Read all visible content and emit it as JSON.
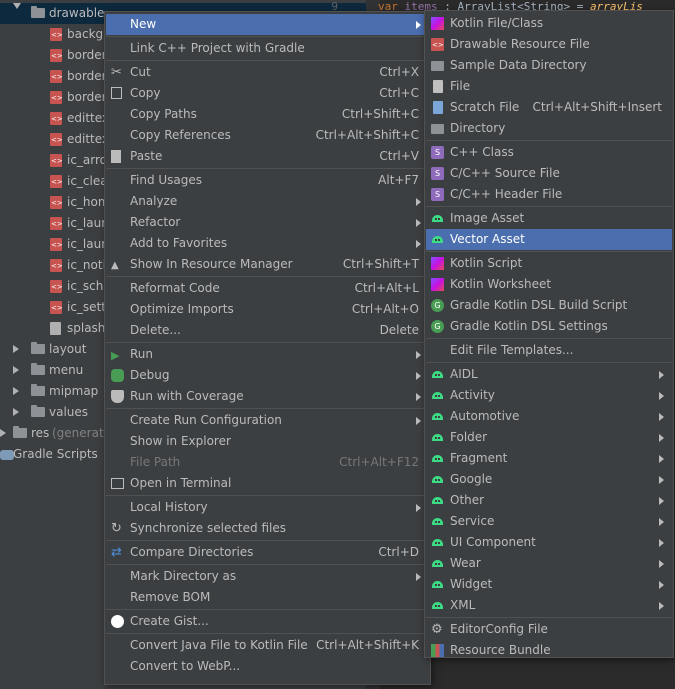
{
  "editor": {
    "line_number": "9",
    "keyword": "var",
    "var_name": "items",
    "type": ": ArrayList<String> =",
    "fn": "arrayLis"
  },
  "tree": {
    "drawable": "drawable",
    "files": [
      "backgro",
      "border_",
      "border_",
      "border_",
      "edittex",
      "edittex",
      "ic_arrov",
      "ic_clear",
      "ic_hom",
      "ic_laun",
      "ic_laun",
      "ic_notif",
      "ic_scho",
      "ic_setti",
      "splash_"
    ],
    "layout": "layout",
    "menu": "menu",
    "mipmap": "mipmap",
    "values": "values",
    "res": "res",
    "res_suffix": "(generated",
    "gradle": "Gradle Scripts"
  },
  "menu1": [
    {
      "label": "New",
      "shortcut": "",
      "sub": true,
      "sel": true
    },
    {
      "label": "Link C++ Project with Gradle",
      "shortcut": ""
    },
    {
      "label": "Cut",
      "shortcut": "Ctrl+X",
      "icon": "cut"
    },
    {
      "label": "Copy",
      "shortcut": "Ctrl+C",
      "icon": "copy"
    },
    {
      "label": "Copy Paths",
      "shortcut": "Ctrl+Shift+C"
    },
    {
      "label": "Copy References",
      "shortcut": "Ctrl+Alt+Shift+C"
    },
    {
      "label": "Paste",
      "shortcut": "Ctrl+V",
      "icon": "paste"
    },
    {
      "label": "Find Usages",
      "shortcut": "Alt+F7"
    },
    {
      "label": "Analyze",
      "shortcut": "",
      "sub": true
    },
    {
      "label": "Refactor",
      "shortcut": "",
      "sub": true
    },
    {
      "label": "Add to Favorites",
      "shortcut": "",
      "sub": true
    },
    {
      "label": "Show In Resource Manager",
      "shortcut": "Ctrl+Shift+T",
      "icon": "resource"
    },
    {
      "label": "Reformat Code",
      "shortcut": "Ctrl+Alt+L"
    },
    {
      "label": "Optimize Imports",
      "shortcut": "Ctrl+Alt+O"
    },
    {
      "label": "Delete...",
      "shortcut": "Delete"
    },
    {
      "label": "Run",
      "shortcut": "",
      "sub": true,
      "icon": "run"
    },
    {
      "label": "Debug",
      "shortcut": "",
      "sub": true,
      "icon": "debug"
    },
    {
      "label": "Run with Coverage",
      "shortcut": "",
      "sub": true,
      "icon": "coverage"
    },
    {
      "label": "Create Run Configuration",
      "shortcut": "",
      "sub": true
    },
    {
      "label": "Show in Explorer",
      "shortcut": ""
    },
    {
      "label": "File Path",
      "shortcut": "Ctrl+Alt+F12",
      "disabled": true
    },
    {
      "label": "Open in Terminal",
      "shortcut": "",
      "icon": "terminal"
    },
    {
      "label": "Local History",
      "shortcut": "",
      "sub": true
    },
    {
      "label": "Synchronize selected files",
      "shortcut": "",
      "icon": "sync"
    },
    {
      "label": "Compare Directories",
      "shortcut": "Ctrl+D",
      "icon": "compare"
    },
    {
      "label": "Mark Directory as",
      "shortcut": "",
      "sub": true
    },
    {
      "label": "Remove BOM",
      "shortcut": ""
    },
    {
      "label": "Create Gist...",
      "shortcut": "",
      "icon": "github"
    },
    {
      "label": "Convert Java File to Kotlin File",
      "shortcut": "Ctrl+Alt+Shift+K"
    },
    {
      "label": "Convert to WebP...",
      "shortcut": ""
    }
  ],
  "menu2": [
    {
      "label": "Kotlin File/Class",
      "shortcut": "",
      "icon": "kotlin"
    },
    {
      "label": "Drawable Resource File",
      "shortcut": "",
      "icon": "xml"
    },
    {
      "label": "Sample Data Directory",
      "shortcut": "",
      "icon": "folder"
    },
    {
      "label": "File",
      "shortcut": "",
      "icon": "file"
    },
    {
      "label": "Scratch File",
      "shortcut": "Ctrl+Alt+Shift+Insert",
      "icon": "scratch"
    },
    {
      "label": "Directory",
      "shortcut": "",
      "icon": "folder"
    },
    {
      "label": "C++ Class",
      "shortcut": "",
      "icon": "cpp"
    },
    {
      "label": "C/C++ Source File",
      "shortcut": "",
      "icon": "cpp"
    },
    {
      "label": "C/C++ Header File",
      "shortcut": "",
      "icon": "cpp"
    },
    {
      "label": "Image Asset",
      "shortcut": "",
      "icon": "android"
    },
    {
      "label": "Vector Asset",
      "shortcut": "",
      "icon": "android",
      "sel": true
    },
    {
      "label": "Kotlin Script",
      "shortcut": "",
      "icon": "kotlin"
    },
    {
      "label": "Kotlin Worksheet",
      "shortcut": "",
      "icon": "kotlin"
    },
    {
      "label": "Gradle Kotlin DSL Build Script",
      "shortcut": "",
      "icon": "gradle"
    },
    {
      "label": "Gradle Kotlin DSL Settings",
      "shortcut": "",
      "icon": "gradle"
    },
    {
      "label": "Edit File Templates...",
      "shortcut": ""
    },
    {
      "label": "AIDL",
      "sub": true,
      "icon": "android"
    },
    {
      "label": "Activity",
      "sub": true,
      "icon": "android"
    },
    {
      "label": "Automotive",
      "sub": true,
      "icon": "android"
    },
    {
      "label": "Folder",
      "sub": true,
      "icon": "android"
    },
    {
      "label": "Fragment",
      "sub": true,
      "icon": "android"
    },
    {
      "label": "Google",
      "sub": true,
      "icon": "android"
    },
    {
      "label": "Other",
      "sub": true,
      "icon": "android"
    },
    {
      "label": "Service",
      "sub": true,
      "icon": "android"
    },
    {
      "label": "UI Component",
      "sub": true,
      "icon": "android"
    },
    {
      "label": "Wear",
      "sub": true,
      "icon": "android"
    },
    {
      "label": "Widget",
      "sub": true,
      "icon": "android"
    },
    {
      "label": "XML",
      "sub": true,
      "icon": "android"
    },
    {
      "label": "EditorConfig File",
      "shortcut": "",
      "icon": "gear"
    },
    {
      "label": "Resource Bundle",
      "shortcut": "",
      "icon": "bundle"
    }
  ]
}
